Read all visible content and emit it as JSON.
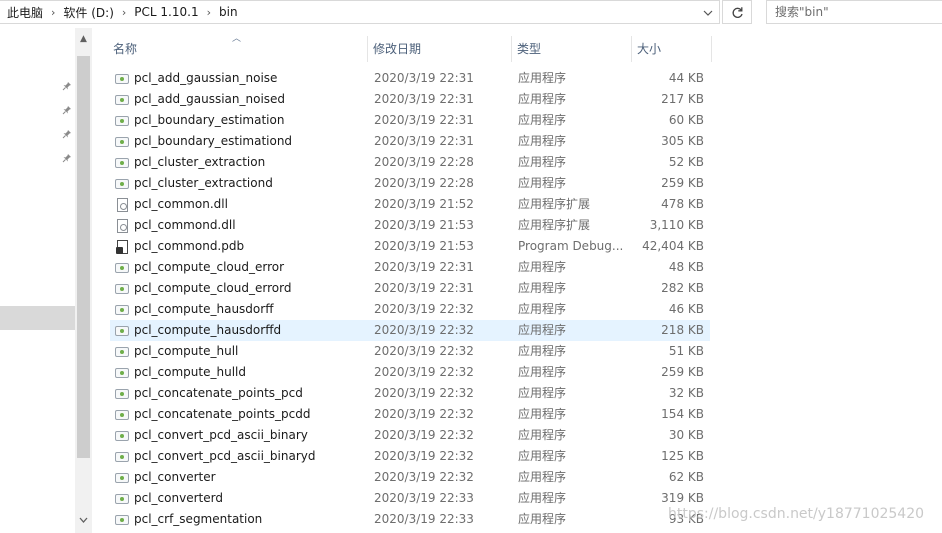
{
  "address": {
    "breadcrumbs": [
      "此电脑",
      "软件 (D:)",
      "PCL 1.10.1",
      "bin"
    ],
    "separator": "›",
    "dropdown_icon": "chevron-down-icon",
    "refresh_icon": "refresh-icon"
  },
  "search": {
    "placeholder": "搜索\"bin\""
  },
  "columns": {
    "name": "名称",
    "date": "修改日期",
    "type": "类型",
    "size": "大小"
  },
  "files": [
    {
      "name": "pcl_add_gaussian_noise",
      "date": "2020/3/19 22:31",
      "type": "应用程序",
      "size": "44 KB",
      "icon": "exe-icon"
    },
    {
      "name": "pcl_add_gaussian_noised",
      "date": "2020/3/19 22:31",
      "type": "应用程序",
      "size": "217 KB",
      "icon": "exe-icon"
    },
    {
      "name": "pcl_boundary_estimation",
      "date": "2020/3/19 22:31",
      "type": "应用程序",
      "size": "60 KB",
      "icon": "exe-icon"
    },
    {
      "name": "pcl_boundary_estimationd",
      "date": "2020/3/19 22:31",
      "type": "应用程序",
      "size": "305 KB",
      "icon": "exe-icon"
    },
    {
      "name": "pcl_cluster_extraction",
      "date": "2020/3/19 22:28",
      "type": "应用程序",
      "size": "52 KB",
      "icon": "exe-icon"
    },
    {
      "name": "pcl_cluster_extractiond",
      "date": "2020/3/19 22:28",
      "type": "应用程序",
      "size": "259 KB",
      "icon": "exe-icon"
    },
    {
      "name": "pcl_common.dll",
      "date": "2020/3/19 21:52",
      "type": "应用程序扩展",
      "size": "478 KB",
      "icon": "dll-icon"
    },
    {
      "name": "pcl_commond.dll",
      "date": "2020/3/19 21:53",
      "type": "应用程序扩展",
      "size": "3,110 KB",
      "icon": "dll-icon"
    },
    {
      "name": "pcl_commond.pdb",
      "date": "2020/3/19 21:53",
      "type": "Program Debug...",
      "size": "42,404 KB",
      "icon": "pdb-icon"
    },
    {
      "name": "pcl_compute_cloud_error",
      "date": "2020/3/19 22:31",
      "type": "应用程序",
      "size": "48 KB",
      "icon": "exe-icon"
    },
    {
      "name": "pcl_compute_cloud_errord",
      "date": "2020/3/19 22:31",
      "type": "应用程序",
      "size": "282 KB",
      "icon": "exe-icon"
    },
    {
      "name": "pcl_compute_hausdorff",
      "date": "2020/3/19 22:32",
      "type": "应用程序",
      "size": "46 KB",
      "icon": "exe-icon"
    },
    {
      "name": "pcl_compute_hausdorffd",
      "date": "2020/3/19 22:32",
      "type": "应用程序",
      "size": "218 KB",
      "icon": "exe-icon",
      "hover": true
    },
    {
      "name": "pcl_compute_hull",
      "date": "2020/3/19 22:32",
      "type": "应用程序",
      "size": "51 KB",
      "icon": "exe-icon"
    },
    {
      "name": "pcl_compute_hulld",
      "date": "2020/3/19 22:32",
      "type": "应用程序",
      "size": "259 KB",
      "icon": "exe-icon"
    },
    {
      "name": "pcl_concatenate_points_pcd",
      "date": "2020/3/19 22:32",
      "type": "应用程序",
      "size": "32 KB",
      "icon": "exe-icon"
    },
    {
      "name": "pcl_concatenate_points_pcdd",
      "date": "2020/3/19 22:32",
      "type": "应用程序",
      "size": "154 KB",
      "icon": "exe-icon"
    },
    {
      "name": "pcl_convert_pcd_ascii_binary",
      "date": "2020/3/19 22:32",
      "type": "应用程序",
      "size": "30 KB",
      "icon": "exe-icon"
    },
    {
      "name": "pcl_convert_pcd_ascii_binaryd",
      "date": "2020/3/19 22:32",
      "type": "应用程序",
      "size": "125 KB",
      "icon": "exe-icon"
    },
    {
      "name": "pcl_converter",
      "date": "2020/3/19 22:32",
      "type": "应用程序",
      "size": "62 KB",
      "icon": "exe-icon"
    },
    {
      "name": "pcl_converterd",
      "date": "2020/3/19 22:33",
      "type": "应用程序",
      "size": "319 KB",
      "icon": "exe-icon"
    },
    {
      "name": "pcl_crf_segmentation",
      "date": "2020/3/19 22:33",
      "type": "应用程序",
      "size": "93 KB",
      "icon": "exe-icon"
    }
  ],
  "watermark": "https://blog.csdn.net/y18771025420"
}
